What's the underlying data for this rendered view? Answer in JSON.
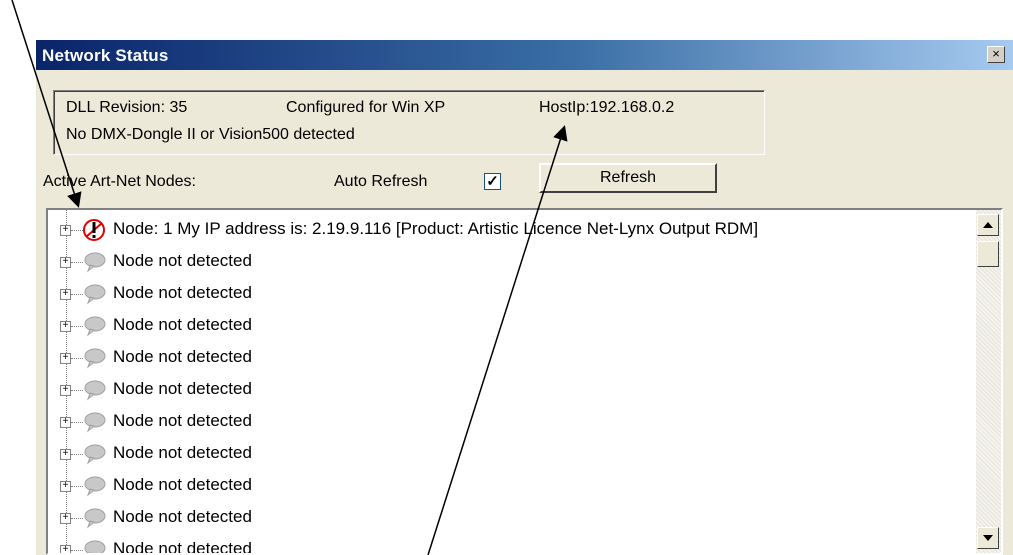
{
  "window": {
    "title": "Network Status",
    "close_label": "×"
  },
  "info": {
    "dll_revision": "DLL Revision: 35",
    "configured": "Configured for Win XP",
    "host_ip": "HostIp:192.168.0.2",
    "dongle_status": "No DMX-Dongle II or Vision500 detected"
  },
  "controls": {
    "active_nodes_label": "Active Art-Net Nodes:",
    "auto_refresh_label": "Auto Refresh",
    "auto_refresh_checked": true,
    "checkbox_mark": "✓",
    "refresh_label": "Refresh"
  },
  "nodes": [
    {
      "label": "Node: 1  My IP address is: 2.19.9.116 [Product: Artistic Licence Net-Lynx Output RDM]",
      "icon": "warning-icon"
    },
    {
      "label": "Node not detected",
      "icon": "speech-bubble-icon"
    },
    {
      "label": "Node not detected",
      "icon": "speech-bubble-icon"
    },
    {
      "label": "Node not detected",
      "icon": "speech-bubble-icon"
    },
    {
      "label": "Node not detected",
      "icon": "speech-bubble-icon"
    },
    {
      "label": "Node not detected",
      "icon": "speech-bubble-icon"
    },
    {
      "label": "Node not detected",
      "icon": "speech-bubble-icon"
    },
    {
      "label": "Node not detected",
      "icon": "speech-bubble-icon"
    },
    {
      "label": "Node not detected",
      "icon": "speech-bubble-icon"
    },
    {
      "label": "Node not detected",
      "icon": "speech-bubble-icon"
    },
    {
      "label": "Node not detected",
      "icon": "speech-bubble-icon"
    }
  ],
  "colors": {
    "title_gradient_start": "#0a246a",
    "title_gradient_end": "#a6caf0",
    "window_bg": "#ece9d8",
    "warning_red": "#e00000"
  }
}
